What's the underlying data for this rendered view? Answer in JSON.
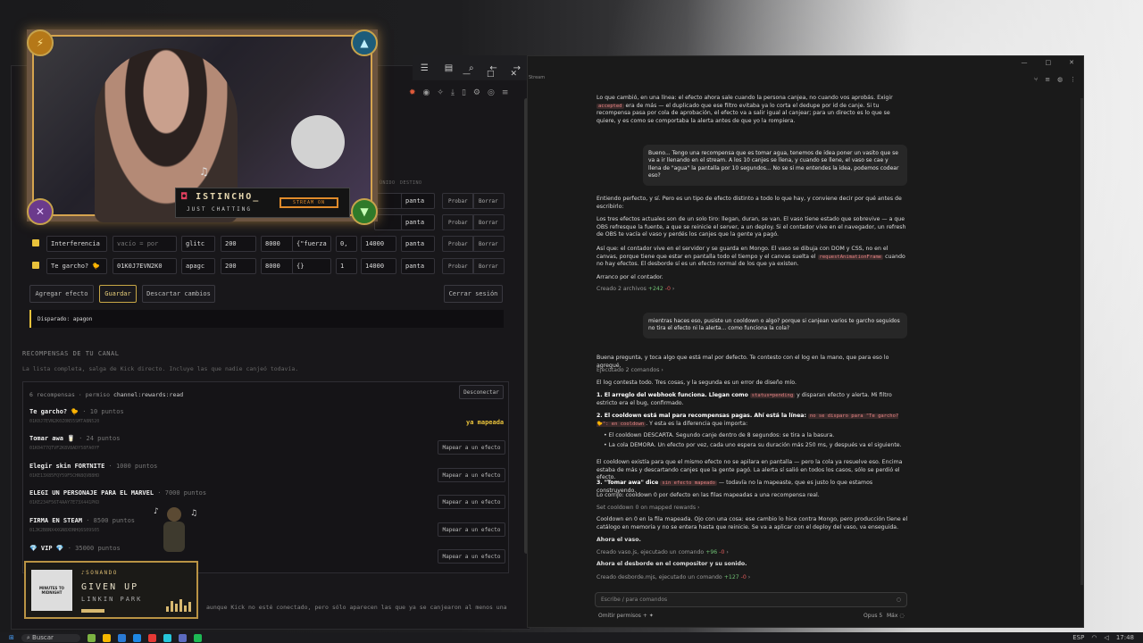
{
  "taskbar": {
    "search": "Buscar",
    "lang": "ESP",
    "time": "17:48"
  },
  "leftwin": {
    "cols": [
      "ÚNIDO",
      "DESTINO"
    ],
    "rows": [
      {
        "name": "",
        "event": "",
        "target": "",
        "a": "",
        "b": "",
        "c": "",
        "d": "",
        "e": "",
        "dest": "panta",
        "test": "Probar",
        "del": "Borrar"
      },
      {
        "name": "",
        "event": "",
        "target": "",
        "a": "",
        "b": "",
        "c": "",
        "d": "",
        "e": "",
        "dest": "panta",
        "test": "Probar",
        "del": "Borrar"
      },
      {
        "name": "Interferencia",
        "event": "vacío = por",
        "target": "glitc",
        "a": "200",
        "b": "8000",
        "c": "{\"fuerza",
        "d": "0,",
        "e": "14000",
        "dest": "panta",
        "test": "Probar",
        "del": "Borrar"
      },
      {
        "name": "Te garcho? 🐤",
        "event": "01K0J7EVN2K0",
        "target": "apagc",
        "a": "200",
        "b": "8000",
        "c": "{}",
        "d": "1",
        "e": "14000",
        "dest": "panta",
        "test": "Probar",
        "del": "Borrar"
      }
    ],
    "actions": {
      "add": "Agregar efecto",
      "save": "Guardar",
      "discard": "Descartar cambios",
      "logout": "Cerrar sesión"
    },
    "fired": "Disparado: apagon",
    "rewards_title": "RECOMPENSAS DE TU CANAL",
    "rewards_desc": "La lista completa, salga de Kick directo. Incluye las que nadie canjeó todavía.",
    "rewards_meta": "6 recompensas · permiso",
    "rewards_perm": "channel:rewards:read",
    "disconnect": "Desconectar",
    "rewards": [
      {
        "name": "Te garcho? 🐤",
        "pts": "· 10 puntos",
        "id": "01K0J7EVN2K0Z0N55SMTA8N520",
        "action": "ya mapeada"
      },
      {
        "name": "Tomar awa 🥛",
        "pts": "· 24 puntos",
        "id": "01K0477QTVF2K8V8ADY58FA0YF",
        "action": "Mapear a un efecto"
      },
      {
        "name": "Elegir skin FORTNITE",
        "pts": "· 1000 puntos",
        "id": "01KE13X85FQY59F5CHN8QVB8HD",
        "action": "Mapear a un efecto"
      },
      {
        "name": "ELEGI UN PERSONAJE PARA EL MARVEL",
        "pts": "· 7000 puntos",
        "id": "01KE234F56T4AAY7E73X441PKD",
        "action": "Mapear a un efecto"
      },
      {
        "name": "FIRMA EN STEAM",
        "pts": "· 8500 puntos",
        "id": "01JK2B8NX4XGN8XDNHQ6S09S05",
        "action": "Mapear a un efecto"
      },
      {
        "name": "💎 VIP 💎",
        "pts": "· 35000 puntos",
        "id": "",
        "action": "Mapear a un efecto"
      }
    ],
    "bottom_text": "aunque Kick no esté conectado, pero sólo aparecen las que ya se canjearon al menos una"
  },
  "overlay": {
    "name": "ISTINCHO_",
    "sub": "JUST CHATTING",
    "stream": "STREAM ON"
  },
  "nowplaying": {
    "label": "♪SONANDO",
    "song": "GIVEN UP",
    "artist": "LINKIN PARK",
    "album": "MINUTES TO MIDNIGHT"
  },
  "chat": {
    "tab": "Stream",
    "p1a": "Lo que cambió, en una línea: el efecto ahora sale cuando la persona canjea, no cuando vos aprobás. Exigir",
    "p1code": "accepted",
    "p1b": "era de más — el duplicado que ese filtro evitaba ya lo corta el dedupe por id de canje. Si tu recompensa pasa por cola de aprobación, el efecto va a salir igual al canjear; para un directo es lo que se quiere, y es como se comportaba la alerta antes de que yo la rompiera.",
    "u1": "Bueno... Tengo una recompensa que es tomar agua, tenemos de idea poner un vasito que se va a ir llenando en el stream. A los 10 canjes se llena, y cuando se llene, el vaso se cae y llena de \"agua\" la pantalla por 10 segundos... No se si me entendes la idea, podemos codear eso?",
    "p2": "Entiendo perfecto, y sí. Pero es un tipo de efecto distinto a todo lo que hay, y conviene decir por qué antes de escribirlo:",
    "p3": "Los tres efectos actuales son de un solo tiro: llegan, duran, se van. El vaso tiene estado que sobrevive — a que OBS refresque la fuente, a que se reinicie el server, a un deploy. Si el contador vive en el navegador, un refresh de OBS te vacía el vaso y perdés los canjes que la gente ya pagó.",
    "p4a": "Así que: el contador vive en el servidor y se guarda en Mongo. El vaso se dibuja con DOM y CSS, no en el canvas, porque tiene que estar en pantalla todo el tiempo y el canvas suelta el",
    "p4code": "requestAnimationFrame",
    "p4b": "cuando no hay efectos. El desborde sí es un efecto normal de los que ya existen.",
    "p5": "Arranco por el contador.",
    "c1": "Creado 2 archivos",
    "c1n": "+242",
    "u2": "mientras haces eso, pusiste un cooldown o algo? porque si canjean varios te garcho seguidos no tira el efecto ni la alerta... como funciona la cola?",
    "p6": "Buena pregunta, y toca algo que está mal por defecto. Te contesto con el log en la mano, que para eso lo agregué.",
    "c2": "Ejecutado 2 comandos",
    "p7": "El log contesta todo. Tres cosas, y la segunda es un error de diseño mío.",
    "p8a": "1. El arreglo del webhook funciona. Llegan como",
    "p8code": "status=pending",
    "p8b": "y disparan efecto y alerta. Mi filtro estricto era el bug, confirmado.",
    "p9a": "2. El cooldown está mal para recompensas pagas. Ahí está la línea:",
    "p9code": "no se disparo para \"Te garcho? 🐤\": en cooldown",
    "p9b": ". Y esta es la diferencia que importa:",
    "b1": "El cooldown DESCARTA. Segundo canje dentro de 8 segundos: se tira a la basura.",
    "b2": "La cola DEMORA. Un efecto por vez, cada uno espera su duración más 250 ms, y después va el siguiente.",
    "p10": "El cooldown existía para que el mismo efecto no se apilara en pantalla — pero la cola ya resuelve eso. Encima estaba de más y descartando canjes que la gente pagó. La alerta sí salió en todos los casos, sólo se perdió el efecto.",
    "p11a": "3. \"Tomar awa\" dice",
    "p11code": "sin efecto mapeado",
    "p11b": "— todavía no la mapeaste, que es justo lo que estamos construyendo.",
    "p12": "Lo corrijo: cooldown 0 por defecto en las filas mapeadas a una recompensa real.",
    "c3": "Set cooldown 0 on mapped rewards",
    "p13": "Cooldown en 0 en la fila mapeada. Ojo con una cosa: ese cambio lo hice contra Mongo, pero producción tiene el catálogo en memoria y no se entera hasta que reinicie. Se va a aplicar con el deploy del vaso, va enseguida.",
    "p14": "Ahora el vaso.",
    "c4": "Creado vaso.js, ejecutado un comando",
    "c4n": "+96",
    "p15": "Ahora el desborde en el compositor y su sonido.",
    "c5": "Creado desborde.mjs, ejecutado un comando",
    "c5n": "+127",
    "input": "Escribe / para comandos",
    "perm": "Omitir permisos",
    "model": "Opus 5",
    "effort": "Máx"
  }
}
